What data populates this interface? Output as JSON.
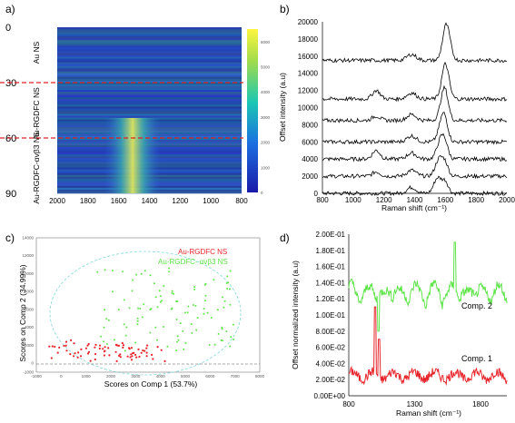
{
  "panels": [
    {
      "id": "a",
      "label": "a)"
    },
    {
      "id": "b",
      "label": "b)"
    },
    {
      "id": "c",
      "label": "c)"
    },
    {
      "id": "d",
      "label": "d)"
    }
  ],
  "colors": {
    "heat_low": "#1a1aa8",
    "heat_mid": "#19c7b4",
    "heat_high": "#fdf53c",
    "red": "#e8242b",
    "green": "#5fe44a",
    "black": "#000000"
  },
  "chart_data": [
    {
      "panel": "a",
      "type": "heatmap",
      "title": "",
      "x_ticks": [
        "2000",
        "1800",
        "1600",
        "1400",
        "1200",
        "1000",
        "800"
      ],
      "xlim": [
        2000,
        800
      ],
      "y_ticks": [
        "0",
        "30",
        "60",
        "90"
      ],
      "ylim": [
        0,
        90
      ],
      "row_labels": [
        "Au NS",
        "Au-RGDFC NS",
        "Au-RGDFC-αvβ3 NS"
      ],
      "dashed_lines_at": [
        30,
        60
      ],
      "dashed_color": "red",
      "colorbar_ticks": [
        "0",
        "1000",
        "2000",
        "3000",
        "4000",
        "5000",
        "6000"
      ],
      "colorbar_range": [
        0,
        6500
      ],
      "bright_band_center": 1600
    },
    {
      "panel": "b",
      "type": "line",
      "xlabel": "Raman shift (cm⁻¹)",
      "ylabel": "Offset intensity (a.u)",
      "x_ticks": [
        "800",
        "1000",
        "1200",
        "1400",
        "1600",
        "1800",
        "2000"
      ],
      "xlim": [
        800,
        2000
      ],
      "y_ticks": [
        "0",
        "2000",
        "4000",
        "6000",
        "8000",
        "10000",
        "12000",
        "14000",
        "16000",
        "18000",
        "20000"
      ],
      "ylim": [
        0,
        20000
      ],
      "series_count": 7,
      "offsets": [
        0,
        2000,
        4000,
        6000,
        8500,
        11000,
        15500
      ]
    },
    {
      "panel": "c",
      "type": "scatter",
      "xlabel": "Scores on Comp 1 (53.7%)",
      "ylabel": "Scores on Comp 2 (34.99%)",
      "legend": [
        {
          "name": "Au-RGDFC NS",
          "color": "red"
        },
        {
          "name": "Au-RGDFC- αvβ3 NS",
          "color": "green"
        }
      ],
      "legend_position": "top-right",
      "xlim": [
        -1000,
        8000
      ],
      "ylim": [
        -1000,
        14000
      ],
      "x_ticks": [
        "-1000",
        "0",
        "1000",
        "2000",
        "3000",
        "4000",
        "5000",
        "6000",
        "7000",
        "8000"
      ],
      "y_ticks": [
        "-1000",
        "0",
        "2000",
        "4000",
        "6000",
        "8000",
        "10000",
        "12000",
        "14000"
      ],
      "zero_line": 0
    },
    {
      "panel": "d",
      "type": "line",
      "xlabel": "Raman shift (cm⁻¹)",
      "ylabel": "Offset normalized intensity (a.u)",
      "x_ticks": [
        "800",
        "1300",
        "1800"
      ],
      "xlim": [
        800,
        2000
      ],
      "y_ticks": [
        "0.00E+00",
        "2.00E-02",
        "4.00E-02",
        "6.00E-02",
        "8.00E-02",
        "1.00E-01",
        "1.20E-01",
        "1.40E-01",
        "1.60E-01",
        "1.80E-01",
        "2.00E-01"
      ],
      "ylim": [
        0,
        0.2
      ],
      "series": [
        {
          "name": "Comp. 1",
          "color": "red",
          "baseline": 0.025
        },
        {
          "name": "Comp. 2",
          "color": "green",
          "baseline": 0.115
        }
      ]
    }
  ]
}
